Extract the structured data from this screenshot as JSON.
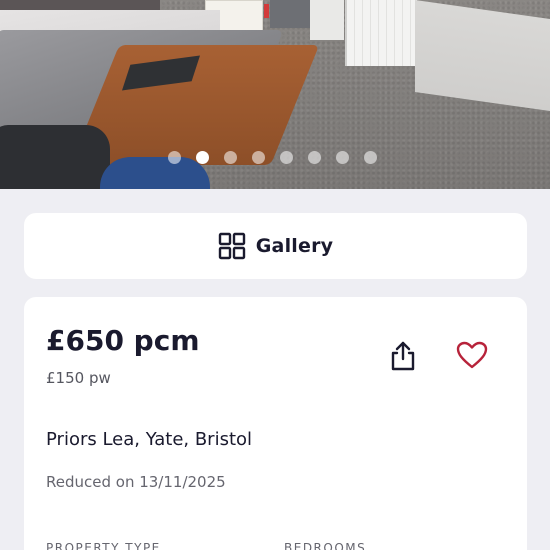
{
  "carousel": {
    "slide_count": 8,
    "active_index": 1
  },
  "gallery": {
    "label": "Gallery",
    "icon": "grid-icon"
  },
  "listing": {
    "price": "£650 pcm",
    "price_weekly": "£150 pw",
    "address": "Priors Lea, Yate, Bristol",
    "reduced": "Reduced on 13/11/2025",
    "share_icon": "share-icon",
    "favorite_icon": "heart-icon"
  },
  "specs": [
    {
      "label": "PROPERTY TYPE"
    },
    {
      "label": "BEDROOMS"
    }
  ],
  "colors": {
    "page_background": "#eeeef3",
    "text_primary": "#1a1a2e",
    "favorite_accent": "#b7233a",
    "active_dot": "#ffffff"
  }
}
